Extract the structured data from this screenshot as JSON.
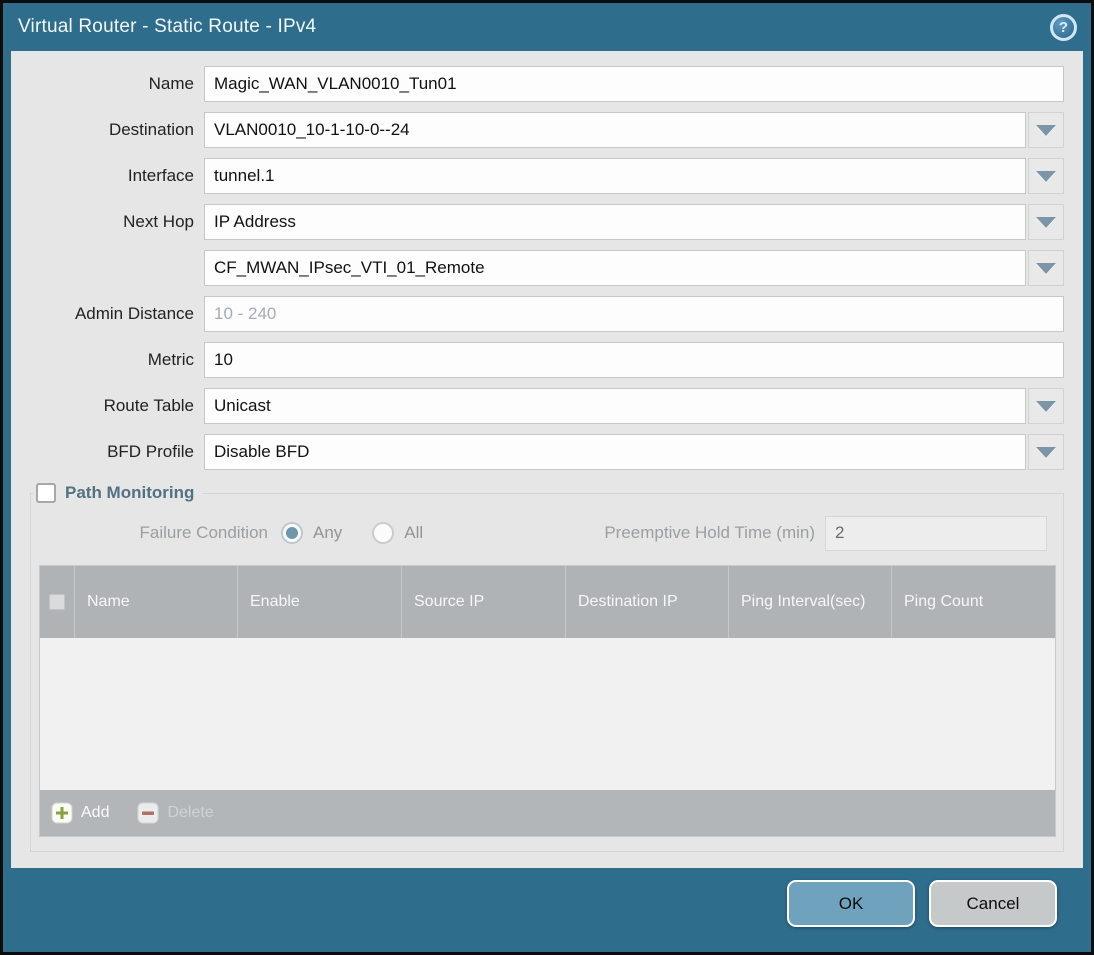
{
  "window": {
    "title": "Virtual Router - Static Route - IPv4",
    "help_glyph": "?"
  },
  "form": {
    "name": {
      "label": "Name",
      "value": "Magic_WAN_VLAN0010_Tun01"
    },
    "destination": {
      "label": "Destination",
      "value": "VLAN0010_10-1-10-0--24"
    },
    "interface": {
      "label": "Interface",
      "value": "tunnel.1"
    },
    "next_hop": {
      "label": "Next Hop",
      "type_value": "IP Address",
      "address_value": "CF_MWAN_IPsec_VTI_01_Remote"
    },
    "admin_distance": {
      "label": "Admin Distance",
      "placeholder": "10 - 240"
    },
    "metric": {
      "label": "Metric",
      "value": "10"
    },
    "route_table": {
      "label": "Route Table",
      "value": "Unicast"
    },
    "bfd_profile": {
      "label": "BFD Profile",
      "value": "Disable BFD"
    }
  },
  "path_monitoring": {
    "title": "Path Monitoring",
    "enabled": false,
    "failure_condition": {
      "label": "Failure Condition",
      "options": [
        "Any",
        "All"
      ],
      "selected": "Any"
    },
    "preemptive_hold_time": {
      "label": "Preemptive Hold Time (min)",
      "value": "2"
    },
    "table": {
      "headers": [
        "Name",
        "Enable",
        "Source IP",
        "Destination IP",
        "Ping Interval(sec)",
        "Ping Count"
      ],
      "rows": []
    },
    "toolbar": {
      "add_label": "Add",
      "delete_label": "Delete"
    }
  },
  "footer": {
    "ok_label": "OK",
    "cancel_label": "Cancel"
  },
  "colors": {
    "titlebar_bg": "#2f6d8d",
    "content_bg": "#e6e6e7",
    "ok_button_bg": "#6fa3bd",
    "cancel_button_bg": "#c6c9ca",
    "table_header_bg": "#afb3b5",
    "radio_selected": "#6e99ac",
    "add_icon_green": "#85a23b",
    "delete_icon_red": "#a65a49"
  }
}
